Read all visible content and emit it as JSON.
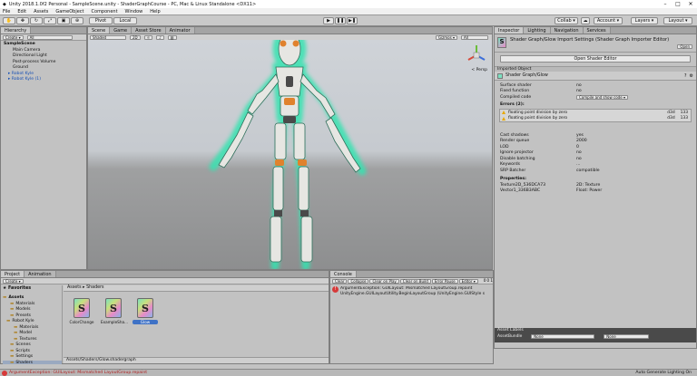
{
  "window": {
    "title": "Unity 2018.1.0f2 Personal - SampleScene.unity - ShaderGraphCourse - PC, Mac & Linux Standalone <DX11>",
    "min": "–",
    "max": "□",
    "close": "✕"
  },
  "menu": [
    "File",
    "Edit",
    "Assets",
    "GameObject",
    "Component",
    "Window",
    "Help"
  ],
  "toolbar": {
    "pivot": "Pivot",
    "local": "Local",
    "collab": "Collab ▾",
    "account": "Account ▾",
    "layers": "Layers ▾",
    "layout": "Layout ▾",
    "play": "▶",
    "pause": "❚❚",
    "step": "▶❚"
  },
  "hierarchy": {
    "tab": "Hierarchy",
    "create": "Create ▾",
    "search_placeholder": "All",
    "items": [
      {
        "label": "SampleScene",
        "indent": 0,
        "style": "bold"
      },
      {
        "label": "Main Camera",
        "indent": 2
      },
      {
        "label": "Directional Light",
        "indent": 2
      },
      {
        "label": "Post-process Volume",
        "indent": 2
      },
      {
        "label": "Ground",
        "indent": 2
      },
      {
        "label": "▸ Robot Kyle",
        "indent": 1,
        "style": "blue"
      },
      {
        "label": "▸ Robot Kyle (1)",
        "indent": 1,
        "style": "blue"
      }
    ]
  },
  "scene": {
    "tabs": [
      "Scene",
      "Game",
      "Asset Store",
      "Animator"
    ],
    "shading": "Shaded",
    "mode2d": "2D",
    "gizmos": "Gizmos ▾",
    "search_placeholder": "All",
    "persp": "< Persp"
  },
  "inspector": {
    "tabs": [
      "Inspector",
      "Lighting",
      "Navigation",
      "Services"
    ],
    "header": "Shader Graph/Glow Import Settings (Shader Graph Importer Editor)",
    "open_button": "Open",
    "open_shader_editor": "Open Shader Editor",
    "imported_object_label": "Imported Object",
    "shader_name": "Shader Graph/Glow",
    "props1": [
      [
        "Surface shader",
        "no"
      ],
      [
        "Fixed function",
        "no"
      ]
    ],
    "compiled_code_label": "Compiled code",
    "compiled_code_button": "Compile and show code ▾",
    "errors_title": "Errors (2):",
    "errors": [
      {
        "msg": "floating point division by zero",
        "platform": "d3d",
        "line": "133"
      },
      {
        "msg": "floating point division by zero",
        "platform": "d3d",
        "line": "133"
      }
    ],
    "props2": [
      [
        "Cast shadows",
        "yes"
      ],
      [
        "Render queue",
        "2000"
      ],
      [
        "LOD",
        "0"
      ],
      [
        "Ignore projector",
        "no"
      ],
      [
        "Disable batching",
        "no"
      ],
      [
        "Keywords",
        "..."
      ],
      [
        "SRP Batcher",
        "compatible"
      ]
    ],
    "properties_title": "Properties:",
    "properties": [
      [
        "Texture2D_536DCA73",
        "2D: Texture"
      ],
      [
        "Vector1_336B3ABC",
        "Float: Power"
      ]
    ],
    "asset_labels": "Asset Labels",
    "assetbundle_label": "AssetBundle",
    "assetbundle_value": "None",
    "assetbundle_variant": "None"
  },
  "project": {
    "tabs": [
      "Project",
      "Animation"
    ],
    "create": "Create ▾",
    "favorites": "Favorites",
    "tree": [
      {
        "label": "Assets",
        "indent": 0,
        "style": "bold"
      },
      {
        "label": "Materials",
        "indent": 2
      },
      {
        "label": "Models",
        "indent": 2
      },
      {
        "label": "Presets",
        "indent": 2
      },
      {
        "label": "Robot Kyle",
        "indent": 1
      },
      {
        "label": "Materials",
        "indent": 3
      },
      {
        "label": "Model",
        "indent": 3
      },
      {
        "label": "Textures",
        "indent": 3
      },
      {
        "label": "Scenes",
        "indent": 2
      },
      {
        "label": "Scripts",
        "indent": 2
      },
      {
        "label": "Settings",
        "indent": 2
      },
      {
        "label": "Shaders",
        "indent": 2,
        "style": "sel"
      },
      {
        "label": "Packages",
        "indent": 0,
        "style": "bold"
      }
    ],
    "breadcrumb": "Assets ▸ Shaders",
    "files": [
      {
        "label": "ColorChange"
      },
      {
        "label": "ExampleSha..."
      },
      {
        "label": "Glow",
        "selected": true
      }
    ],
    "footer_path": "Assets/Shaders/Glow.shadergraph"
  },
  "console": {
    "tab": "Console",
    "buttons": [
      "Clear",
      "Collapse",
      "Clear on Play",
      "Clear on Build",
      "Error Pause",
      "Editor ▾"
    ],
    "counts": [
      "0",
      "0",
      "1"
    ],
    "message_line1": "ArgumentException: GUILayout: Mismatched LayoutGroup.repaint",
    "message_line2": "UnityEngine.GUILayoutUtility.BeginLayoutGroup (UnityEngine.GUIStyle s"
  },
  "status": {
    "message": "ArgumentException: GUILayout: Mismatched LayoutGroup.repaint",
    "right": "Auto Generate Lighting On"
  },
  "colors": {
    "accent": "#3f72c6",
    "error": "#d63a3a",
    "glow": "#35e3b0"
  }
}
